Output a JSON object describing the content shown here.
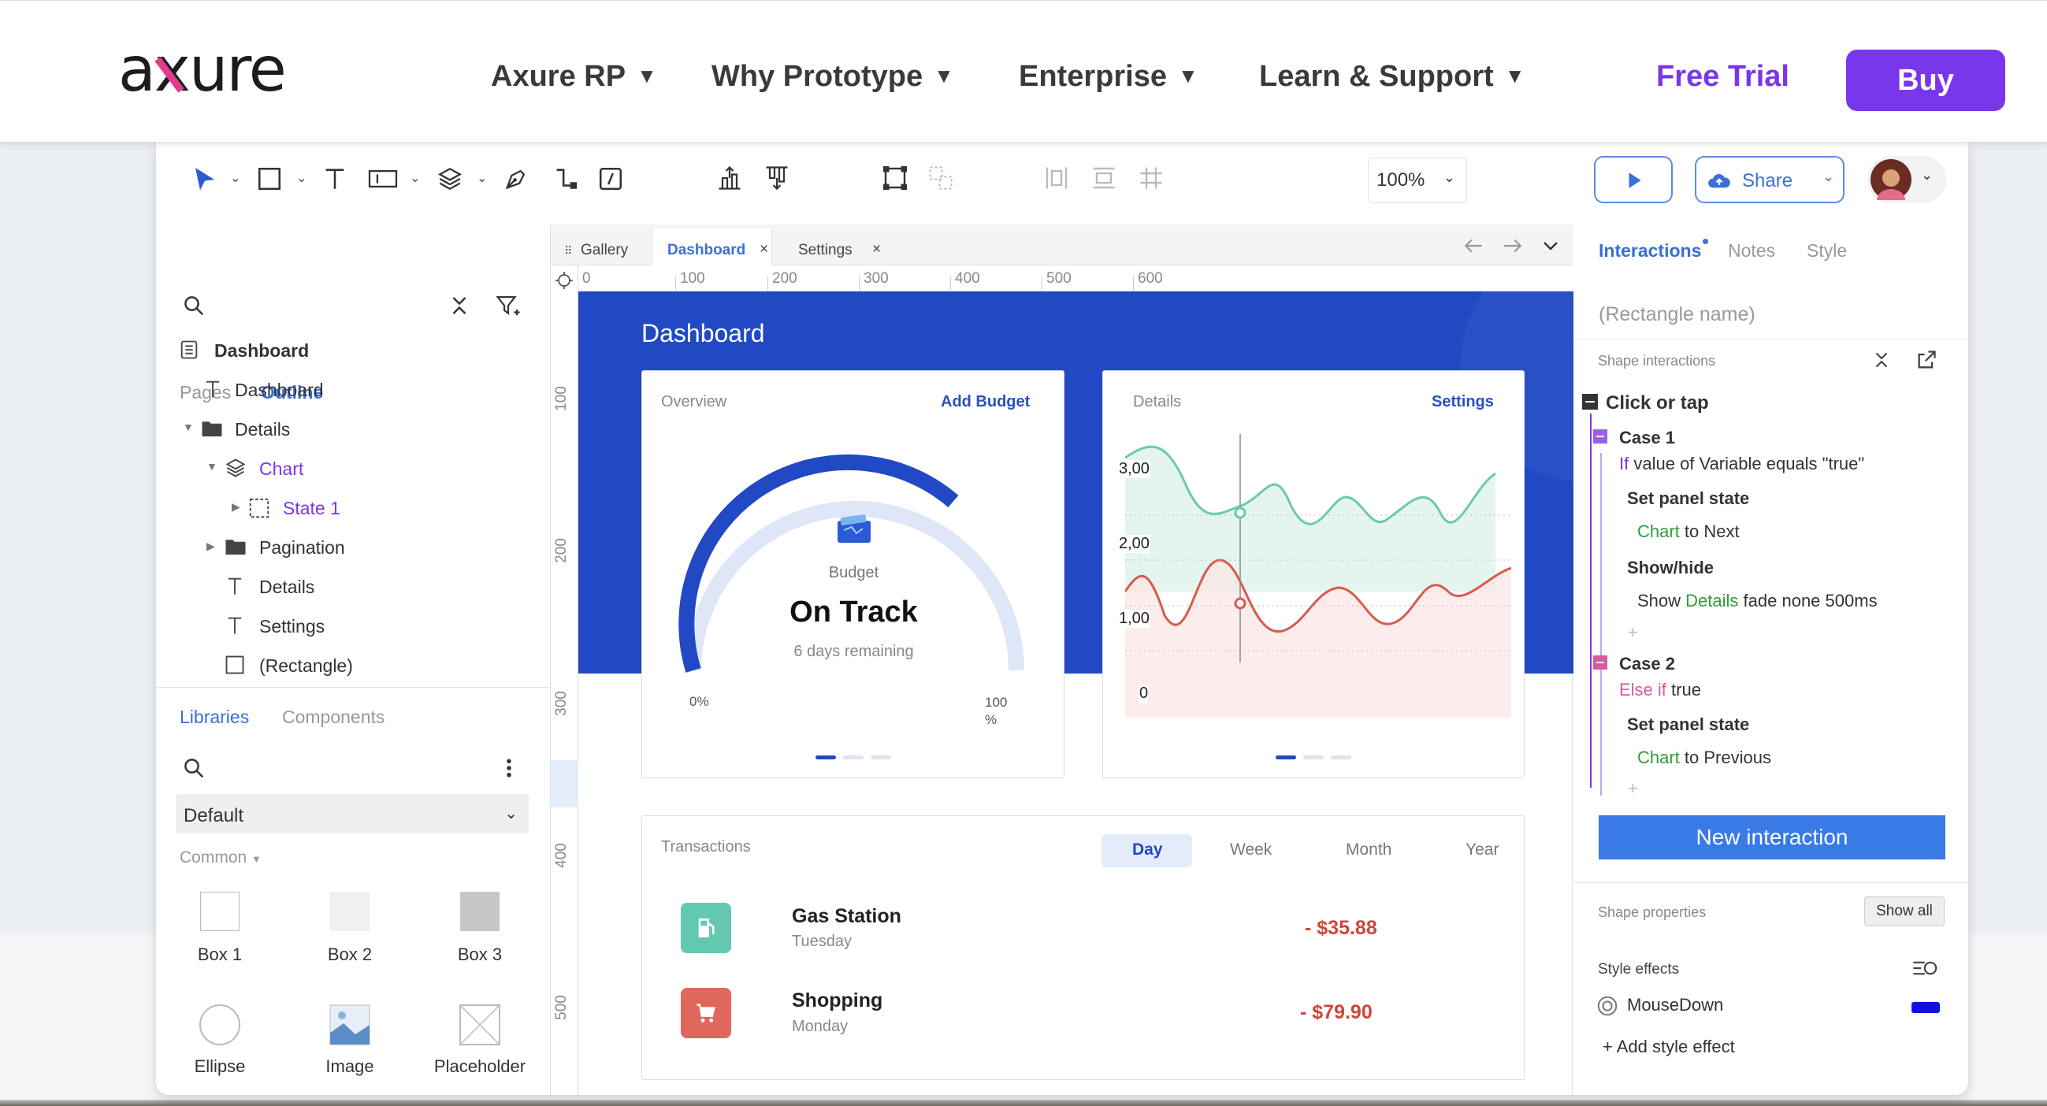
{
  "nav": {
    "logo_text": "axure",
    "links": [
      {
        "label": "Axure RP",
        "caret": "▼"
      },
      {
        "label": "Why Prototype",
        "caret": "▼"
      },
      {
        "label": "Enterprise",
        "caret": "▼"
      },
      {
        "label": "Learn & Support",
        "caret": "▼"
      }
    ],
    "free_trial": "Free Trial",
    "buy": "Buy"
  },
  "toolbar": {
    "zoom": "100%",
    "share": "Share",
    "caret": "⌄"
  },
  "left_panel": {
    "tabs": [
      "Pages",
      "Outline"
    ],
    "outline_tree": [
      {
        "label": "Dashboard",
        "icon": "page-icon"
      },
      {
        "label": "Dashboard",
        "icon": "text-icon"
      },
      {
        "label": "Details",
        "icon": "folder-icon"
      },
      {
        "label": "Chart",
        "icon": "layers-icon"
      },
      {
        "label": "State 1",
        "icon": "state-icon"
      },
      {
        "label": "Pagination",
        "icon": "folder-icon"
      },
      {
        "label": "Details",
        "icon": "text-icon"
      },
      {
        "label": "Settings",
        "icon": "text-icon"
      },
      {
        "label": "(Rectangle)",
        "icon": "rectangle-icon"
      }
    ],
    "lib_tabs": [
      "Libraries",
      "Components"
    ],
    "library_select": "Default",
    "common_label": "Common",
    "widgets": [
      "Box 1",
      "Box 2",
      "Box 3",
      "Ellipse",
      "Image",
      "Placeholder"
    ]
  },
  "canvas": {
    "tabs": [
      "Gallery",
      "Dashboard",
      "Settings"
    ],
    "close": "×",
    "ruler_top": [
      "0",
      "100",
      "200",
      "300",
      "400",
      "500",
      "600"
    ],
    "ruler_left": [
      "100",
      "200",
      "300",
      "400",
      "500"
    ],
    "dashboard_title": "Dashboard",
    "overview": {
      "label": "Overview",
      "link": "Add Budget",
      "budget_label": "Budget",
      "status": "On Track",
      "remaining": "6 days remaining",
      "min": "0%",
      "max": "100 %",
      "progress": 0.68
    },
    "details": {
      "label": "Details",
      "link": "Settings",
      "y_ticks": [
        "3,00",
        "2,00",
        "1,00",
        "0"
      ]
    },
    "transactions": {
      "label": "Transactions",
      "periods": [
        "Day",
        "Week",
        "Month",
        "Year"
      ],
      "active_period": "Day",
      "items": [
        {
          "name": "Gas Station",
          "day": "Tuesday",
          "amount": "- $35.88",
          "color": "#62c9b0"
        },
        {
          "name": "Shopping",
          "day": "Monday",
          "amount": "- $79.90",
          "color": "#e0675c"
        }
      ]
    }
  },
  "right_panel": {
    "tabs": [
      "Interactions",
      "Notes",
      "Style"
    ],
    "name_placeholder": "(Rectangle name)",
    "shape_interactions": "Shape interactions",
    "event": "Click or tap",
    "case1": {
      "title": "Case 1",
      "cond_kw": "If",
      "cond": "value of Variable equals \"true\"",
      "action1": "Set panel state",
      "target1": "Chart",
      "rest1": "to Next",
      "action2": "Show/hide",
      "show": "Show",
      "target2": "Details",
      "rest2": "fade none 500ms"
    },
    "plus": "+",
    "case2": {
      "title": "Case 2",
      "cond_kw": "Else if",
      "cond": "true",
      "action1": "Set panel state",
      "target1": "Chart",
      "rest1": "to Previous"
    },
    "new_interaction": "New interaction",
    "shape_properties": "Shape properties",
    "show_all": "Show all",
    "style_effects": "Style effects",
    "mousedown": "MouseDown",
    "mousedown_color": "#1010e0",
    "add_style_effect": "+ Add style effect"
  },
  "colors": {
    "brand": "#7a36ea",
    "accent": "#3a6fd8",
    "dashboard_blue": "#2249c4"
  }
}
